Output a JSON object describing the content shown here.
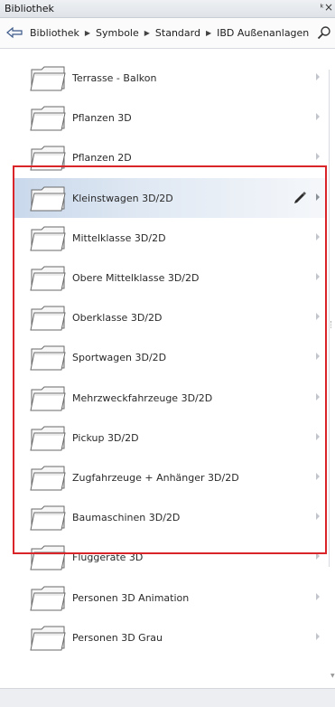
{
  "window": {
    "title": "Bibliothek",
    "pin_glyph": "ᴛ",
    "close_glyph": "×"
  },
  "breadcrumb": {
    "back_icon": "back-arrow-icon",
    "items": [
      "Bibliothek",
      "Symbole",
      "Standard",
      "IBD Außenanlagen"
    ],
    "separator_icon": "triangle-right-icon",
    "search_icon": "search-icon"
  },
  "folders": [
    {
      "label": "Terrasse - Balkon"
    },
    {
      "label": "Pflanzen 3D"
    },
    {
      "label": "Pflanzen 2D"
    },
    {
      "label": "Kleinstwagen 3D/2D",
      "active": true,
      "edit_icon": "pencil-icon"
    },
    {
      "label": "Mittelklasse 3D/2D"
    },
    {
      "label": "Obere Mittelklasse 3D/2D"
    },
    {
      "label": "Oberklasse 3D/2D"
    },
    {
      "label": "Sportwagen 3D/2D"
    },
    {
      "label": "Mehrzweckfahrzeuge 3D/2D"
    },
    {
      "label": "Pickup 3D/2D"
    },
    {
      "label": "Zugfahrzeuge + Anhänger 3D/2D"
    },
    {
      "label": "Baumaschinen 3D/2D"
    },
    {
      "label": "Fluggeräte 3D"
    },
    {
      "label": "Personen 3D Animation"
    },
    {
      "label": "Personen 3D Grau"
    }
  ],
  "colors": {
    "highlight_border": "#d9252a",
    "selected_row": "#c9d8eb"
  }
}
